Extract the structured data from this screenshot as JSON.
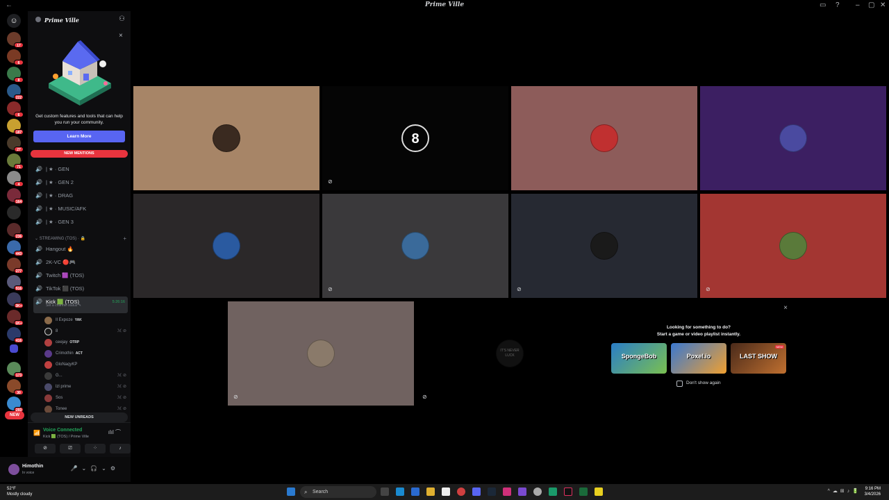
{
  "window": {
    "title": "Prime Ville",
    "back": "←"
  },
  "server": {
    "name": "Prime Ville"
  },
  "promo": {
    "text": "Get custom features and tools that can help you run your community.",
    "button": "Learn More",
    "close": "×"
  },
  "rail": {
    "badges": [
      "17",
      "6",
      "8",
      "222",
      "6",
      "187",
      "27",
      "71",
      "4",
      "164",
      "",
      "236",
      "443",
      "277",
      "916",
      "3K+",
      "1K+",
      "416",
      "",
      "173",
      "30",
      "293"
    ],
    "new_label": "NEW"
  },
  "new_mentions": "NEW MENTIONS",
  "channels_top": [
    {
      "label": "| ★ · GEN"
    },
    {
      "label": "| ★ · GEN 2"
    },
    {
      "label": "| ★ · DRAG"
    },
    {
      "label": "| ★ · MUSIC/AFK"
    },
    {
      "label": "| ★ · GEN 3"
    }
  ],
  "category": {
    "label": "STREAMING (TOS) · 🔒",
    "plus": "+"
  },
  "channels_stream": [
    {
      "label": "Hangout 🔥"
    },
    {
      "label": "2K-VC 🔴🎮"
    },
    {
      "label": "Twitch 🟪 (TOS)"
    },
    {
      "label": "TikTok ⬛ (TOS)"
    }
  ],
  "active_channel": {
    "label": "Kick 🟩 (TOS)",
    "timer": "5:26:16",
    "status": "Set a channel status ✎"
  },
  "members": [
    {
      "name": "Il Expoze",
      "activity": "YAK",
      "muted": ""
    },
    {
      "name": "8",
      "activity": "",
      "muted": "ℳ ⊘"
    },
    {
      "name": "ceejay",
      "activity": "OTRP",
      "muted": ""
    },
    {
      "name": "Crimothin",
      "activity": "ACT",
      "muted": ""
    },
    {
      "name": "GloNaqyKP",
      "activity": "",
      "muted": ""
    },
    {
      "name": "G...",
      "activity": "",
      "muted": "ℳ ⊘"
    },
    {
      "name": "lzl prime",
      "activity": "",
      "muted": "ℳ ⊘"
    },
    {
      "name": "Sos",
      "activity": "",
      "muted": "ℳ ⊘"
    },
    {
      "name": "Tonee",
      "activity": "",
      "muted": "ℳ ⊘"
    }
  ],
  "new_unreads": "NEW UNREADS",
  "voice": {
    "status": "Voice Connected",
    "channel": "Kick 🟩 (TOS) / Prime Ville"
  },
  "user": {
    "name": "Himothin",
    "status": "In voice"
  },
  "tiles": [
    {
      "bg": "#a78567"
    },
    {
      "bg": "#050505",
      "label": "8"
    },
    {
      "bg": "#8d5c5a"
    },
    {
      "bg": "#3c1f62"
    },
    {
      "bg": "#2b2829"
    },
    {
      "bg": "#3a393b"
    },
    {
      "bg": "#262932"
    },
    {
      "bg": "#a33632"
    },
    {
      "bg": "#706260"
    },
    {
      "bg": "#000000",
      "label": "IT'S NEVER LUCK"
    }
  ],
  "activity": {
    "heading": "Looking for something to do?",
    "sub": "Start a game or video playlist instantly.",
    "games": [
      {
        "name": "SpongeBob",
        "color": "#2a7dc7",
        "new": ""
      },
      {
        "name": "Poxel.io",
        "color": "#3a78d0",
        "new": ""
      },
      {
        "name": "LAST SHOW",
        "color": "#4a2a1a",
        "new": "NEW"
      }
    ],
    "checkbox": "Don't show again",
    "close": "×"
  },
  "taskbar": {
    "temp": "52°F",
    "weather": "Mostly cloudy",
    "search": "Search",
    "time": "9:16 PM",
    "date": "3/4/2026"
  }
}
